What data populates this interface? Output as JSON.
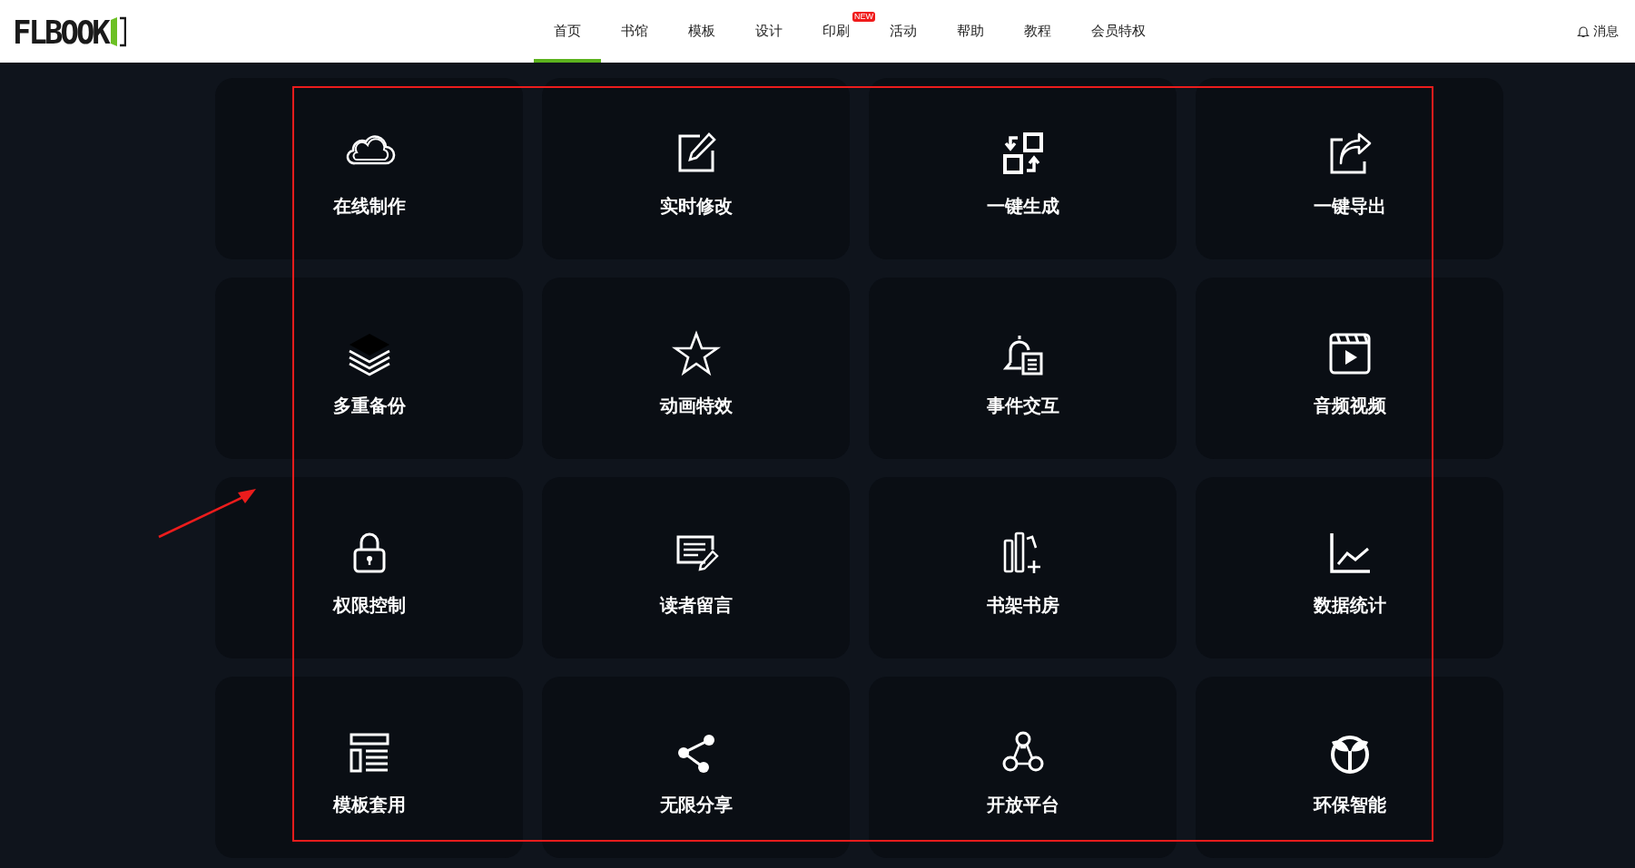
{
  "header": {
    "logo": "FLBOOK",
    "nav": [
      {
        "label": "首页",
        "selected": true
      },
      {
        "label": "书馆",
        "selected": false
      },
      {
        "label": "模板",
        "selected": false
      },
      {
        "label": "设计",
        "selected": false
      },
      {
        "label": "印刷",
        "selected": false,
        "badge": "NEW"
      },
      {
        "label": "活动",
        "selected": false
      },
      {
        "label": "帮助",
        "selected": false
      },
      {
        "label": "教程",
        "selected": false
      },
      {
        "label": "会员特权",
        "selected": false
      }
    ],
    "messages": "消息"
  },
  "features": [
    {
      "label": "在线制作"
    },
    {
      "label": "实时修改"
    },
    {
      "label": "一键生成"
    },
    {
      "label": "一键导出"
    },
    {
      "label": "多重备份"
    },
    {
      "label": "动画特效"
    },
    {
      "label": "事件交互"
    },
    {
      "label": "音频视频"
    },
    {
      "label": "权限控制"
    },
    {
      "label": "读者留言"
    },
    {
      "label": "书架书房"
    },
    {
      "label": "数据统计"
    },
    {
      "label": "模板套用"
    },
    {
      "label": "无限分享"
    },
    {
      "label": "开放平台"
    },
    {
      "label": "环保智能"
    }
  ]
}
